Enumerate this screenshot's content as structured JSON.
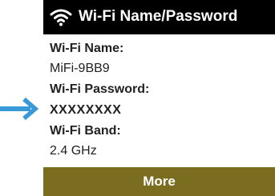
{
  "header": {
    "title": "Wi-Fi Name/Password",
    "icon": "wifi-icon"
  },
  "info": {
    "name_label": "Wi-Fi Name:",
    "name_value": "MiFi-9BB9",
    "password_label": "Wi-Fi Password:",
    "password_value": "XXXXXXXX",
    "band_label": "Wi-Fi Band:",
    "band_value": "2.4 GHz"
  },
  "footer": {
    "more_label": "More"
  },
  "colors": {
    "title_bar": "#000000",
    "button": "#7b6d1f",
    "arrow": "#3a9ad9"
  }
}
